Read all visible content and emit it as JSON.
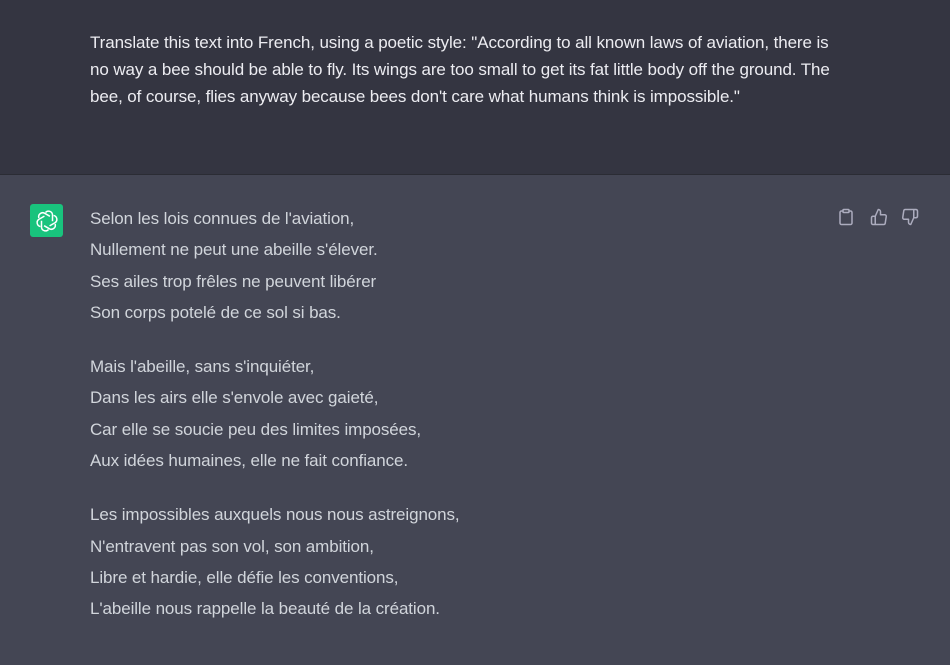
{
  "user_message": {
    "text": "Translate this text into French, using a poetic style: \"According to all known laws of aviation, there is no way a bee should be able to fly. Its wings are too small to get its fat little body off the ground. The bee, of course, flies anyway because bees don't care what humans think is impossible.\""
  },
  "assistant": {
    "avatar_icon": "openai-logo-icon",
    "avatar_color": "#19c37d",
    "stanzas": [
      {
        "lines": [
          "Selon les lois connues de l'aviation,",
          "Nullement ne peut une abeille s'élever.",
          "Ses ailes trop frêles ne peuvent libérer",
          "Son corps potelé de ce sol si bas."
        ]
      },
      {
        "lines": [
          "Mais l'abeille, sans s'inquiéter,",
          "Dans les airs elle s'envole avec gaieté,",
          "Car elle se soucie peu des limites imposées,",
          "Aux idées humaines, elle ne fait confiance."
        ]
      },
      {
        "lines": [
          "Les impossibles auxquels nous nous astreignons,",
          "N'entravent pas son vol, son ambition,",
          "Libre et hardie, elle défie les conventions,",
          "L'abeille nous rappelle la beauté de la création."
        ]
      }
    ],
    "actions": [
      "clipboard-icon",
      "thumbs-up-icon",
      "thumbs-down-icon"
    ]
  },
  "colors": {
    "user_bg": "#343541",
    "assistant_bg": "#444654",
    "text": "#d1d5db",
    "icon": "#acacbe"
  }
}
